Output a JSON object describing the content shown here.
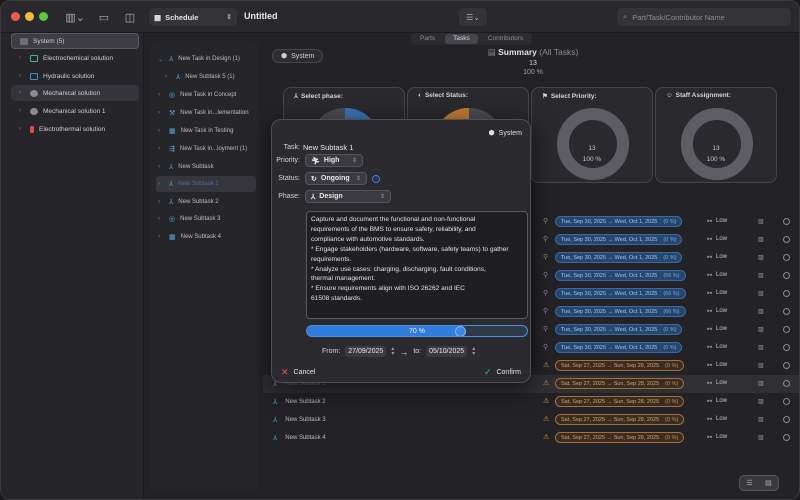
{
  "toolbar": {
    "schedule_label": "Schedule",
    "doc_title": "Untitled",
    "search_placeholder": "Part/Task/Contributor Name"
  },
  "sidebar": {
    "items": [
      {
        "label": "System (5)",
        "icon": "system-icon",
        "color": "#7a7a80"
      },
      {
        "label": "Electrochemical solution",
        "icon": "battery-icon",
        "color": "#3fb98a"
      },
      {
        "label": "Hydraulic solution",
        "icon": "hydraulic-icon",
        "color": "#3a8fd8"
      },
      {
        "label": "Mechanical solution",
        "icon": "gear-icon",
        "color": "#8a8a90"
      },
      {
        "label": "Mechanical solution 1",
        "icon": "gear-icon",
        "color": "#8a8a90"
      },
      {
        "label": "Electrothermal solution",
        "icon": "thermal-icon",
        "color": "#e0484a"
      }
    ]
  },
  "tree": {
    "items": [
      {
        "label": "New Task in Design (1)",
        "expanded": true
      },
      {
        "label": "New Subtask 5 (1)",
        "expanded": false
      },
      {
        "label": "New Task in Concept"
      },
      {
        "label": "New Task in...lementation"
      },
      {
        "label": "New Task in Testing"
      },
      {
        "label": "New Task in...loyment (1)"
      },
      {
        "label": "New Subtask"
      },
      {
        "label": "New Subtask 1"
      },
      {
        "label": "New Subtask 2"
      },
      {
        "label": "New Subtask 3"
      },
      {
        "label": "New Subtask 4"
      }
    ]
  },
  "main": {
    "tabs": [
      {
        "label": "Parts",
        "active": false
      },
      {
        "label": "Tasks",
        "active": true
      },
      {
        "label": "Contributors",
        "active": false
      }
    ],
    "system_pill": "System",
    "summary": {
      "title": "Summary",
      "subtitle": "(All Tasks)",
      "count": "13",
      "percent": "100 %"
    },
    "cards": [
      {
        "title": "Select phase:",
        "count": "",
        "percent": ""
      },
      {
        "title": "Select Status:",
        "count": "",
        "percent": ""
      },
      {
        "title": "Select Priority:",
        "count": "13",
        "percent": "100 %"
      },
      {
        "title": "Staff Assignment:",
        "count": "13",
        "percent": "100 %"
      }
    ],
    "rows": [
      {
        "name": "",
        "dates": "Tue, Sep 30, 2025 → Wed, Oct 1, 2025",
        "pct": "(0 %)",
        "style": "blue",
        "priority": "Low"
      },
      {
        "name": "",
        "dates": "Tue, Sep 30, 2025 → Wed, Oct 1, 2025",
        "pct": "(0 %)",
        "style": "blue",
        "priority": "Low"
      },
      {
        "name": "",
        "dates": "Tue, Sep 30, 2025 → Wed, Oct 1, 2025",
        "pct": "(0 %)",
        "style": "blue",
        "priority": "Low"
      },
      {
        "name": "",
        "dates": "Tue, Sep 30, 2025 → Wed, Oct 1, 2025",
        "pct": "(66 %)",
        "style": "blue",
        "priority": "Low"
      },
      {
        "name": "",
        "dates": "Tue, Sep 30, 2025 → Wed, Oct 1, 2025",
        "pct": "(66 %)",
        "style": "blue",
        "priority": "Low"
      },
      {
        "name": "",
        "dates": "Tue, Sep 30, 2025 → Wed, Oct 1, 2025",
        "pct": "(66 %)",
        "style": "blue",
        "priority": "Low"
      },
      {
        "name": "",
        "dates": "Tue, Sep 30, 2025 → Wed, Oct 1, 2025",
        "pct": "(0 %)",
        "style": "blue",
        "priority": "Low"
      },
      {
        "name": "",
        "dates": "Tue, Sep 30, 2025 → Wed, Oct 1, 2025",
        "pct": "(0 %)",
        "style": "blue",
        "priority": "Low"
      },
      {
        "name": "",
        "dates": "Sat, Sep 27, 2025 → Sun, Sep 28, 2025",
        "pct": "(0 %)",
        "style": "orange",
        "priority": "Low"
      },
      {
        "name": "New Subtask 1",
        "dates": "Sat, Sep 27, 2025 → Sun, Sep 28, 2025",
        "pct": "(0 %)",
        "style": "orange",
        "priority": "Low",
        "dim": true
      },
      {
        "name": "New Subtask 2",
        "dates": "Sat, Sep 27, 2025 → Sun, Sep 28, 2025",
        "pct": "(0 %)",
        "style": "orange",
        "priority": "Low"
      },
      {
        "name": "New Subtask 3",
        "dates": "Sat, Sep 27, 2025 → Sun, Sep 28, 2025",
        "pct": "(0 %)",
        "style": "orange",
        "priority": "Low"
      },
      {
        "name": "New Subtask 4",
        "dates": "Sat, Sep 27, 2025 → Sun, Sep 28, 2025",
        "pct": "(0 %)",
        "style": "orange",
        "priority": "Low"
      }
    ]
  },
  "popover": {
    "system_label": "System",
    "task_label": "Task:",
    "task_value": "New Subtask 1",
    "priority_label": "Priority:",
    "priority_value": "High",
    "status_label": "Status:",
    "status_value": "Ongoing",
    "phase_label": "Phase:",
    "phase_value": "Design",
    "description": [
      "Capture and document the functional and non-functional",
      "requirements of the BMS to ensure safety, reliability, and",
      "compliance with automotive standards.",
      "* Engage stakeholders (hardware, software, safety teams) to gather",
      "requirements.",
      "* Analyze use cases: charging, discharging, fault conditions,",
      "thermal management.",
      "* Ensure requirements align with ISO 26262 and IEC",
      "61508 standards."
    ],
    "progress_text": "70 %",
    "progress_value": 0.7,
    "from_label": "From:",
    "from_value": "27/09/2025",
    "to_label": "to:",
    "to_value": "05/10/2025",
    "cancel_label": "Cancel",
    "confirm_label": "Confirm"
  },
  "colors": {
    "accent": "#2f7de1",
    "cancel": "#ef5350",
    "confirm": "#4cc05f"
  }
}
